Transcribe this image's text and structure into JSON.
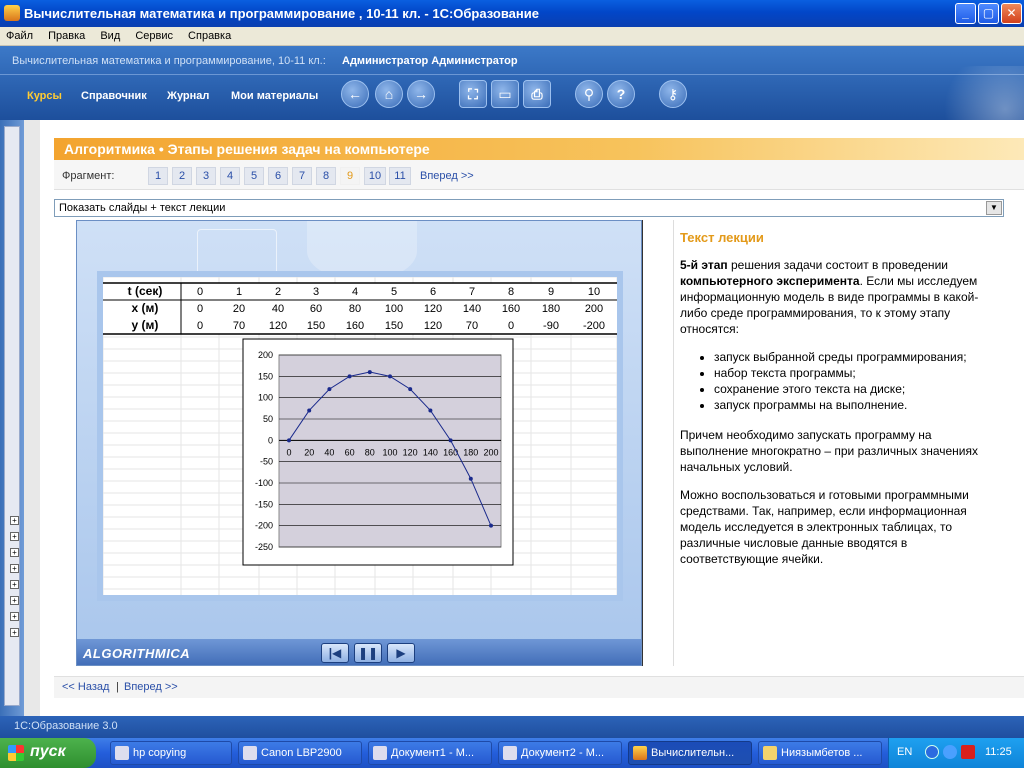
{
  "window": {
    "title": "Вычислительная математика и программирование , 10-11 кл. - 1С:Образование",
    "min_label": "_",
    "max_label": "▢",
    "close_label": "✕"
  },
  "menu": [
    "Файл",
    "Правка",
    "Вид",
    "Сервис",
    "Справка"
  ],
  "header": {
    "crumb": "Вычислительная математика и программирование, 10-11 кл.:",
    "user": "Администратор Администратор",
    "tabs": [
      {
        "label": "Курсы",
        "active": true
      },
      {
        "label": "Справочник",
        "active": false
      },
      {
        "label": "Журнал",
        "active": false
      },
      {
        "label": "Мои материалы",
        "active": false
      }
    ],
    "tools": [
      "arrow-left-icon",
      "home-icon",
      "arrow-right-icon",
      "fullscreen-icon",
      "presentation-icon",
      "print-icon",
      "search-icon",
      "help-icon",
      "key-icon"
    ]
  },
  "lesson": {
    "title": "Алгоритмика • Этапы решения задач на компьютере",
    "fragment_label": "Фрагмент:",
    "fragments": [
      "1",
      "2",
      "3",
      "4",
      "5",
      "6",
      "7",
      "8",
      "9",
      "10",
      "11"
    ],
    "current_fragment": "9",
    "next_label": "Вперед >>",
    "view_mode": "Показать слайды + текст лекции"
  },
  "slide": {
    "brand": "ALGORITHMICA",
    "table": {
      "rows": [
        {
          "head": "t (сек)",
          "cells": [
            "0",
            "1",
            "2",
            "3",
            "4",
            "5",
            "6",
            "7",
            "8",
            "9",
            "10"
          ]
        },
        {
          "head": "x (м)",
          "cells": [
            "0",
            "20",
            "40",
            "60",
            "80",
            "100",
            "120",
            "140",
            "160",
            "180",
            "200"
          ]
        },
        {
          "head": "y (м)",
          "cells": [
            "0",
            "70",
            "120",
            "150",
            "160",
            "150",
            "120",
            "70",
            "0",
            "-90",
            "-200"
          ]
        }
      ]
    },
    "controls": [
      "first-icon",
      "pause-icon",
      "play-icon"
    ]
  },
  "chart_data": {
    "type": "scatter",
    "title": "",
    "xlabel": "",
    "ylabel": "",
    "x": [
      0,
      20,
      40,
      60,
      80,
      100,
      120,
      140,
      160,
      180,
      200
    ],
    "y": [
      0,
      70,
      120,
      150,
      160,
      150,
      120,
      70,
      0,
      -90,
      -200
    ],
    "xlim": [
      0,
      200
    ],
    "ylim": [
      -250,
      200
    ],
    "x_ticks": [
      "0",
      "20",
      "40",
      "60",
      "80",
      "100",
      "120",
      "140",
      "160",
      "180",
      "200"
    ],
    "y_ticks": [
      "200",
      "150",
      "100",
      "50",
      "0",
      "-50",
      "-100",
      "-150",
      "-200",
      "-250"
    ],
    "grid": true,
    "line_color": "#1a2a8c",
    "plot_bg": "#d4d0dc"
  },
  "lecture": {
    "heading": "Текст лекции",
    "p1_bold1": "5-й этап",
    "p1_text1": " решения задачи состоит в проведении ",
    "p1_bold2": "компьютерного эксперимента",
    "p1_text2": ". Если мы исследуем информационную модель в виде программы в какой-либо среде программирования, то к этому этапу относятся:",
    "items": [
      "запуск выбранной среды программирования;",
      "набор текста программы;",
      "сохранение этого текста на диске;",
      "запуск программы на выполнение."
    ],
    "p2": "Причем необходимо запускать программу на выполнение многократно – при различных значениях начальных условий.",
    "p3": "Можно воспользоваться и готовыми программными средствами. Так, например, если информационная модель исследуется в электронных таблицах, то различные числовые данные вводятся в соответствующие ячейки."
  },
  "bottom_nav": {
    "back": "<< Назад",
    "sep": "|",
    "next": "Вперед >>"
  },
  "status": "1С:Образование 3.0",
  "taskbar": {
    "start": "пуск",
    "tasks": [
      {
        "label": "hp copying",
        "active": false
      },
      {
        "label": "Canon LBP2900",
        "active": false
      },
      {
        "label": "Документ1 - М...",
        "active": false
      },
      {
        "label": "Документ2 - М...",
        "active": false
      },
      {
        "label": "Вычислительн...",
        "active": true
      },
      {
        "label": "Ниязымбетов ...",
        "active": false
      }
    ],
    "lang": "EN",
    "clock": "11:25"
  }
}
